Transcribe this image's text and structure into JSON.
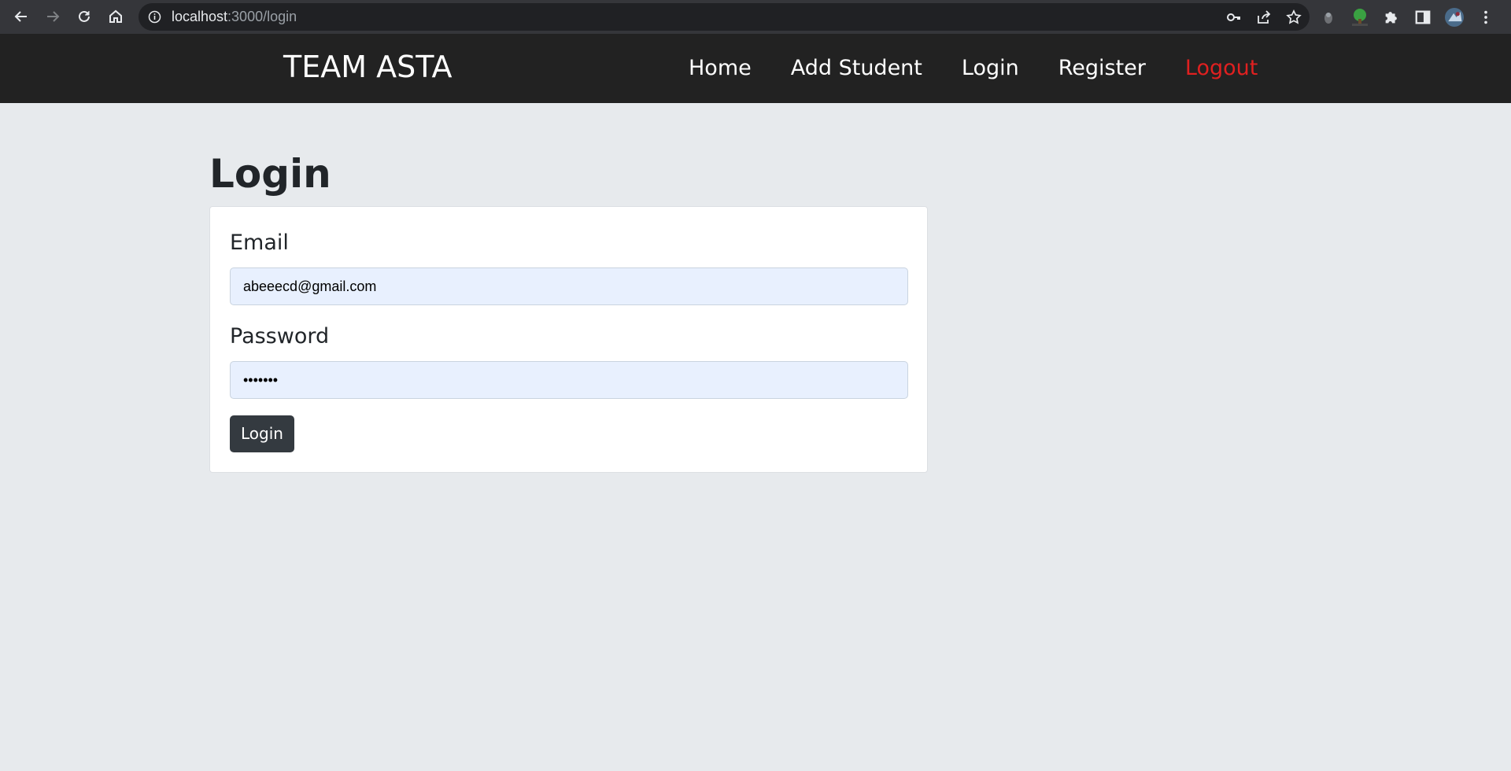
{
  "browser": {
    "url_host": "localhost",
    "url_path": ":3000/login",
    "icons": [
      "back-icon",
      "forward-icon",
      "reload-icon",
      "home-icon",
      "info-icon",
      "key-icon",
      "share-icon",
      "star-icon",
      "extension-icon",
      "puzzle-icon",
      "sidepanel-icon",
      "avatar",
      "menu-icon"
    ]
  },
  "navbar": {
    "brand": "TEAM ASTA",
    "links": [
      {
        "label": "Home"
      },
      {
        "label": "Add Student"
      },
      {
        "label": "Login"
      },
      {
        "label": "Register"
      },
      {
        "label": "Logout",
        "color": "#e02020"
      }
    ]
  },
  "main": {
    "title": "Login",
    "form": {
      "email_label": "Email",
      "email_value": "abeeecd@gmail.com",
      "password_label": "Password",
      "password_value": "•••••••",
      "submit_label": "Login"
    }
  },
  "colors": {
    "navbar_bg": "#222222",
    "page_bg": "#e7eaed",
    "button_bg": "#343a40",
    "autofill_bg": "#e8f0fe"
  }
}
